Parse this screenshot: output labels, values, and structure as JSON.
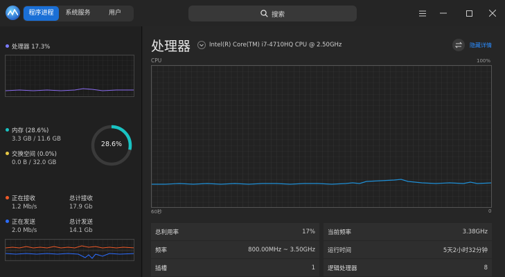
{
  "header": {
    "tabs": [
      {
        "label": "程序进程",
        "active": true
      },
      {
        "label": "系统服务",
        "active": false
      },
      {
        "label": "用户",
        "active": false
      }
    ],
    "search_label": "搜索"
  },
  "sidebar": {
    "cpu": {
      "label": "处理器 17.3%",
      "color": "#7b7bff"
    },
    "memory": {
      "label": "内存 (28.6%)",
      "detail": "3.3 GB / 11.6 GB",
      "color": "#19c3c3"
    },
    "swap": {
      "label": "交换空间 (0.0%)",
      "detail": "0.0 B / 32.0 GB",
      "color": "#e6c845"
    },
    "memory_ring": {
      "label": "28.6%",
      "percent": 28.6
    },
    "network": {
      "recv_label": "正在接收",
      "recv_value": "1.2 Mb/s",
      "recv_color": "#f05a28",
      "total_recv_label": "总计接收",
      "total_recv_value": "17.9 Gb",
      "send_label": "正在发送",
      "send_value": "2.0 Mb/s",
      "send_color": "#2b6cff",
      "total_send_label": "总计发送",
      "total_send_value": "14.1 Gb"
    }
  },
  "main": {
    "title": "处理器",
    "model": "Intel(R) Core(TM) i7-4710HQ CPU @ 2.50GHz",
    "detail_link": "隐藏详情",
    "graph": {
      "label": "CPU",
      "max_label": "100%",
      "time_label": "60秒",
      "min_label": "0",
      "line_color": "#1f8fd6"
    },
    "stats": [
      {
        "key": "总利用率",
        "value": "17%"
      },
      {
        "key": "当前频率",
        "value": "3.38GHz"
      },
      {
        "key": "频率",
        "value": "800.00MHz ~ 3.50GHz"
      },
      {
        "key": "运行时间",
        "value": "5天2小时32分钟"
      },
      {
        "key": "插槽",
        "value": "1"
      },
      {
        "key": "逻辑处理器",
        "value": "8"
      }
    ]
  }
}
